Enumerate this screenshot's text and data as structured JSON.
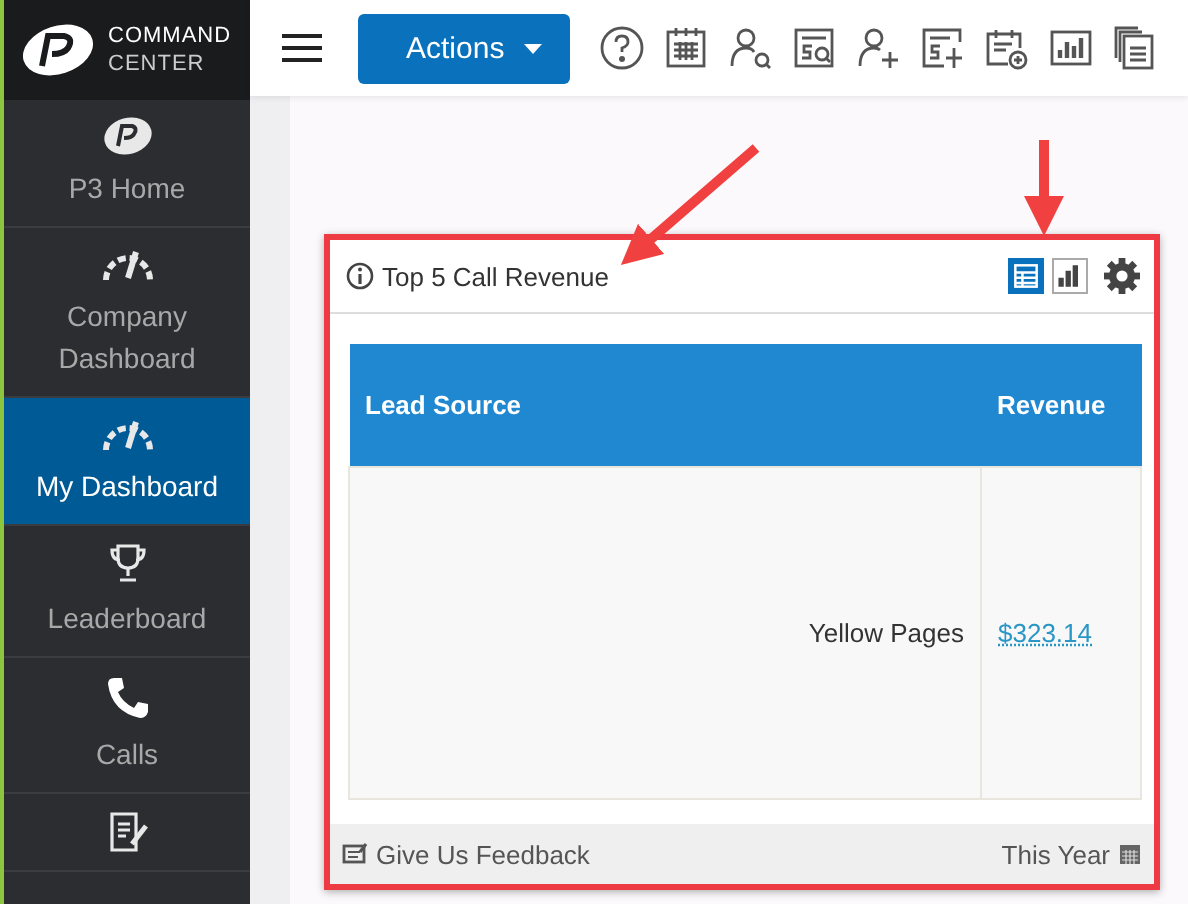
{
  "logo": {
    "line_1": "COMMAND",
    "line_2": "CENTER"
  },
  "topbar": {
    "actions_button": "Actions",
    "tools": [
      {
        "kind": "help"
      },
      {
        "kind": "calendar"
      },
      {
        "kind": "user-search"
      },
      {
        "kind": "dollar-search"
      },
      {
        "kind": "add-user"
      },
      {
        "kind": "add-dollar"
      },
      {
        "kind": "calendar-add"
      },
      {
        "kind": "bar-chart"
      },
      {
        "kind": "documents"
      }
    ]
  },
  "sidebar": {
    "items": [
      {
        "label": "P3 Home",
        "kind": "logo",
        "selected": false
      },
      {
        "label": "Company Dashboard",
        "kind": "gauge",
        "selected": false
      },
      {
        "label": "My Dashboard",
        "kind": "gauge",
        "selected": true
      },
      {
        "label": "Leaderboard",
        "kind": "trophy",
        "selected": false
      },
      {
        "label": "Calls",
        "kind": "phone",
        "selected": false
      },
      {
        "kind": "notes",
        "selected": false
      }
    ]
  },
  "widget": {
    "title": "Top 5 Call Revenue",
    "views": [
      {
        "kind": "table",
        "selected": true
      },
      {
        "kind": "chart",
        "selected": false
      }
    ],
    "table": {
      "columns": [
        "Lead Source",
        "Revenue"
      ],
      "rows": [
        [
          "Yellow Pages",
          "$323.14"
        ]
      ]
    },
    "feedback_link": "Give Us Feedback",
    "period": "This Year"
  }
}
